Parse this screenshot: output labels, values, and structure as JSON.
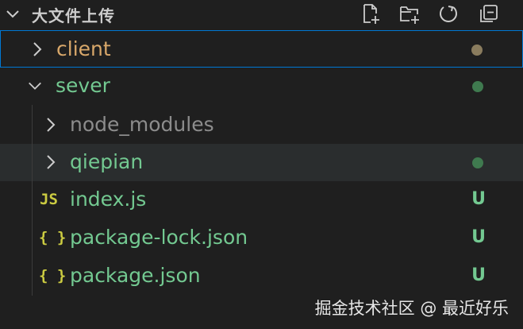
{
  "explorer": {
    "section_title": "大文件上传",
    "actions": [
      {
        "name": "new-file-icon"
      },
      {
        "name": "new-folder-icon"
      },
      {
        "name": "refresh-icon"
      },
      {
        "name": "collapse-all-icon"
      }
    ]
  },
  "tree": {
    "items": [
      {
        "label": "client",
        "type": "folder",
        "expanded": false,
        "color": "#d9a86a",
        "decoration": "dot",
        "decoration_color": "#8a7c5e"
      },
      {
        "label": "sever",
        "type": "folder",
        "expanded": true,
        "color": "#73c991",
        "decoration": "dot",
        "decoration_color": "#3f7a4f"
      },
      {
        "label": "node_modules",
        "type": "folder",
        "expanded": false,
        "color": "#8c8c8c",
        "decoration": "none"
      },
      {
        "label": "qiepian",
        "type": "folder",
        "expanded": false,
        "color": "#73c991",
        "decoration": "dot",
        "decoration_color": "#3f7a4f"
      },
      {
        "label": "index.js",
        "type": "file",
        "icon": "JS",
        "color": "#73c991",
        "decoration": "badge",
        "badge": "U"
      },
      {
        "label": "package-lock.json",
        "type": "file",
        "icon": "{ }",
        "color": "#73c991",
        "decoration": "badge",
        "badge": "U"
      },
      {
        "label": "package.json",
        "type": "file",
        "icon": "{ }",
        "color": "#73c991",
        "decoration": "badge",
        "badge": "U"
      }
    ]
  },
  "watermark": "掘金技术社区 @ 最近好乐"
}
